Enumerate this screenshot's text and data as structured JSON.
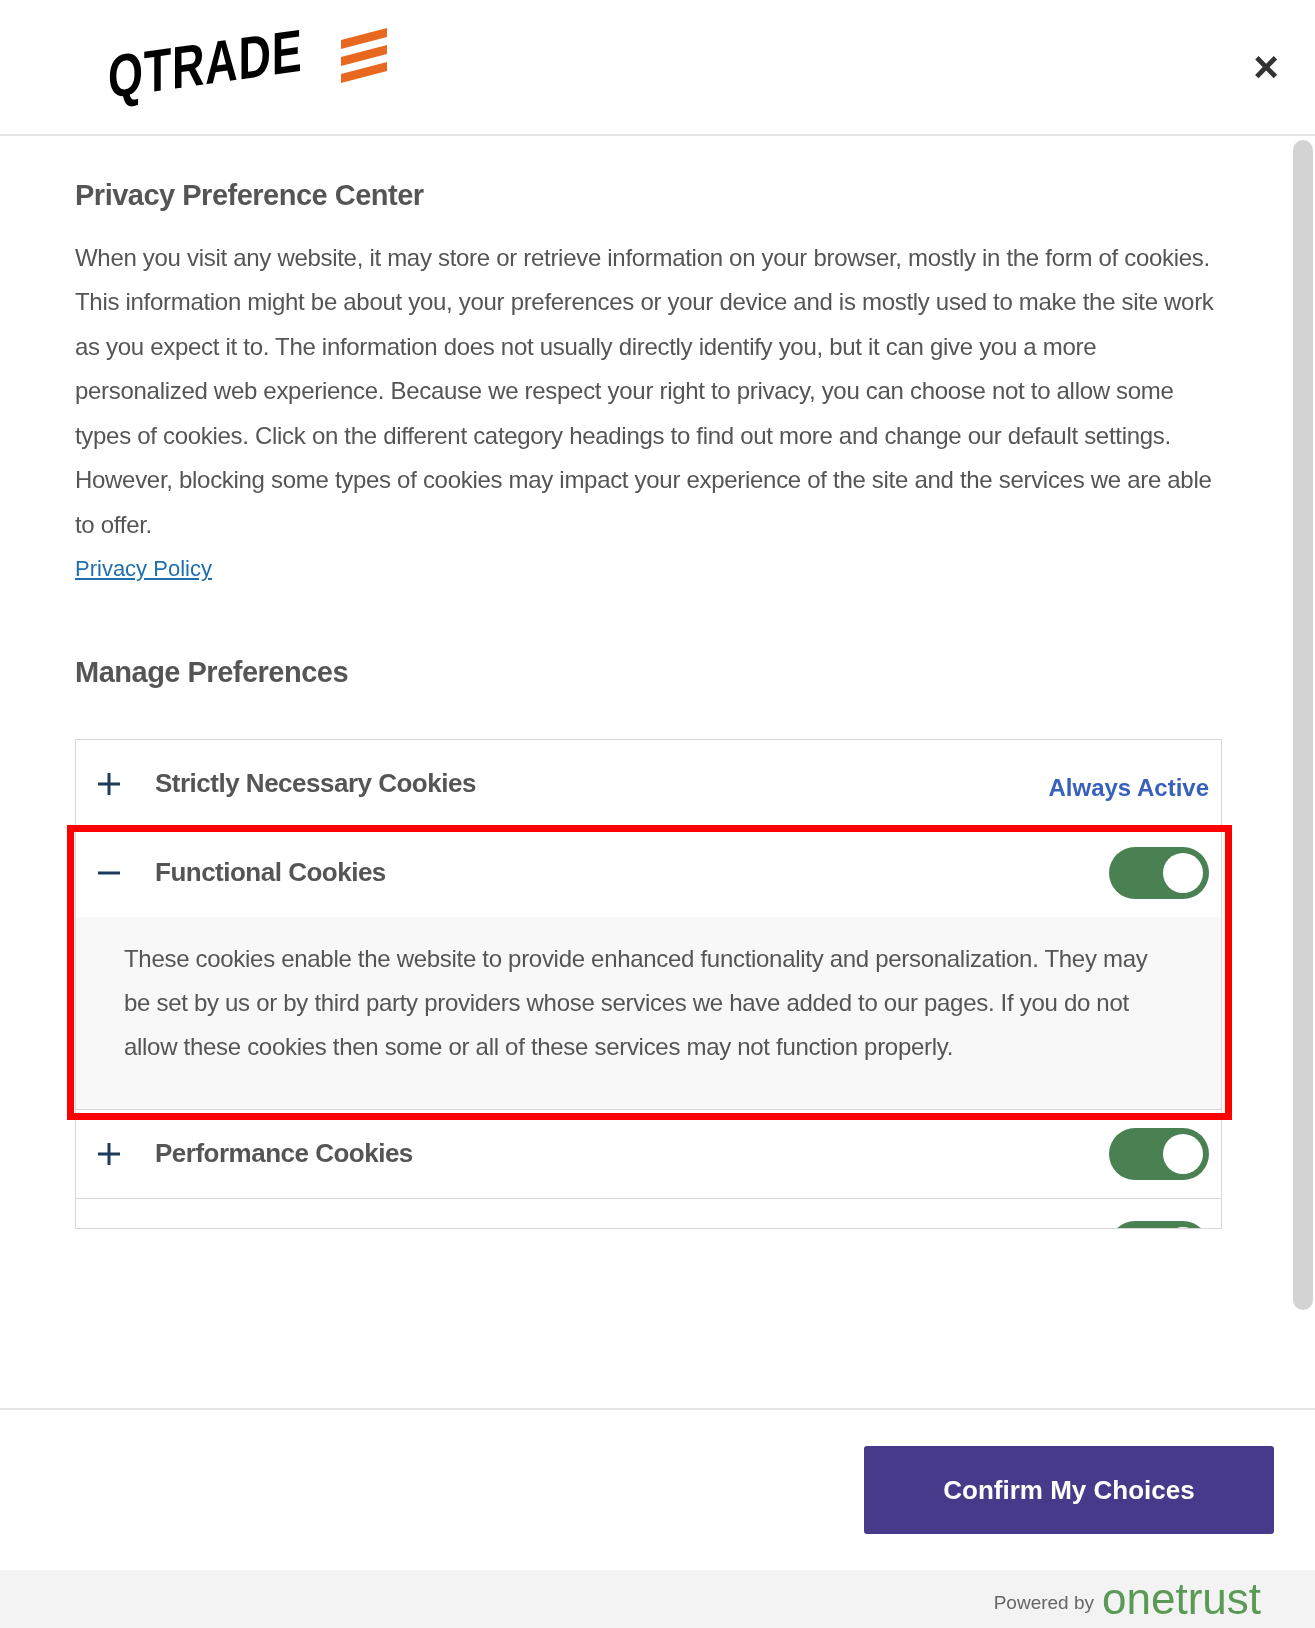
{
  "header": {
    "logo": "QTRADE",
    "close": "×"
  },
  "title": "Privacy Preference Center",
  "intro": "When you visit any website, it may store or retrieve information on your browser, mostly in the form of cookies. This information might be about you, your preferences or your device and is mostly used to make the site work as you expect it to. The information does not usually directly identify you, but it can give you a more personalized web experience. Because we respect your right to privacy, you can choose not to allow some types of cookies. Click on the different category headings to find out more and change our default settings. However, blocking some types of cookies may impact your experience of the site and the services we are able to offer.",
  "privacy_link": "Privacy Policy",
  "manage_title": "Manage Preferences",
  "categories": [
    {
      "kind": "always_active",
      "name": "Strictly Necessary Cookies",
      "expanded": false,
      "status": "Always Active",
      "highlighted": false
    },
    {
      "kind": "toggle",
      "name": "Functional Cookies",
      "expanded": true,
      "on": true,
      "highlighted": true,
      "description": "These cookies enable the website to provide enhanced functionality and personalization. They may be set by us or by third party providers whose services we have added to our pages. If you do not allow these cookies then some or all of these services may not function properly."
    },
    {
      "kind": "toggle",
      "name": "Performance Cookies",
      "expanded": false,
      "on": true,
      "highlighted": false
    },
    {
      "kind": "toggle",
      "on": true,
      "highlighted": false
    }
  ],
  "confirm_button": "Confirm My Choices",
  "footer": {
    "powered_by": "Powered by",
    "brand": "onetrust"
  }
}
